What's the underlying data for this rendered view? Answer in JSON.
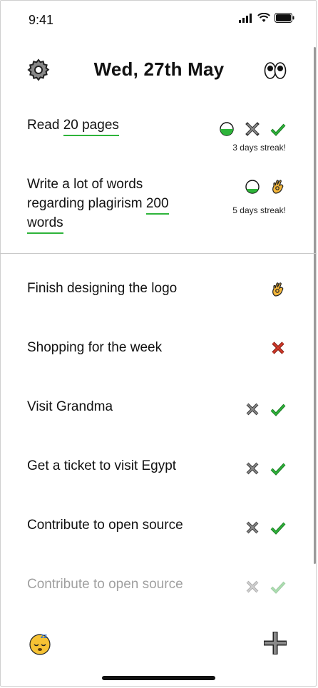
{
  "status_bar": {
    "time": "9:41"
  },
  "header": {
    "date": "Wed, 27th May"
  },
  "habits": [
    {
      "before": "Read ",
      "highlight": "20 pages",
      "after": "",
      "streak": "3 days streak!"
    },
    {
      "line1": "Write a lot of words",
      "line2_before": "regarding plagirism ",
      "line2_highlight": "200",
      "line3_highlight": "words",
      "streak": "5 days streak!"
    }
  ],
  "tasks": [
    {
      "label": "Finish designing the logo"
    },
    {
      "label": "Shopping for the week"
    },
    {
      "label": "Visit Grandma"
    },
    {
      "label": "Get a ticket to visit Egypt"
    },
    {
      "label": "Contribute to open source"
    },
    {
      "label": "Contribute to open source"
    }
  ],
  "icons": {
    "gear": "gear-icon",
    "eyes": "eyes-icon",
    "half_circle": "half-filled-circle-icon",
    "cross": "cross-icon",
    "check": "check-icon",
    "ok_hand": "ok-hand-icon",
    "red_cross": "red-cross-icon",
    "sleep": "sleeping-face-icon",
    "plus": "plus-icon"
  },
  "colors": {
    "green": "#2eb43a",
    "red": "#d23a2a",
    "gray": "#666666",
    "accent_underline": "#2eb43a"
  }
}
